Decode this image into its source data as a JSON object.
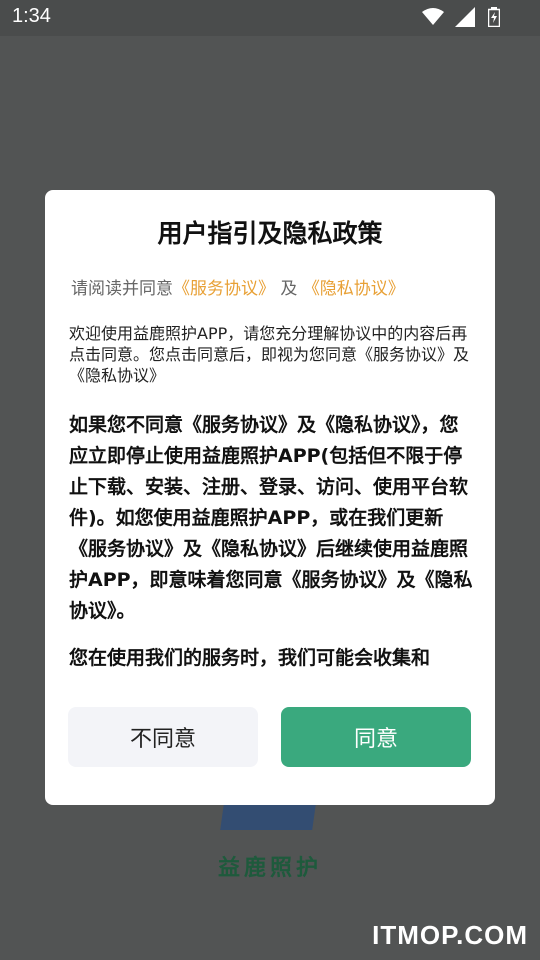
{
  "status_bar": {
    "time": "1:34"
  },
  "background": {
    "app_name": "益鹿照护",
    "watermark": "ITMOP.COM"
  },
  "dialog": {
    "title": "用户指引及隐私政策",
    "subtitle_prefix": "请阅读并同意",
    "service_link": "《服务协议》",
    "subtitle_and": "及",
    "privacy_link": "《隐私协议》",
    "intro": "欢迎使用益鹿照护APP，请您充分理解协议中的内容后再点击同意。您点击同意后，即视为您同意《服务协议》及《隐私协议》",
    "paragraph_1": "如果您不同意《服务协议》及《隐私协议》，您应立即停止使用益鹿照护APP(包括但不限于停止下载、安装、注册、登录、访问、使用平台软件)。如您使用益鹿照护APP，或在我们更新《服务协议》及《隐私协议》后继续使用益鹿照护APP，即意味着您同意《服务协议》及《隐私协议》。",
    "paragraph_2": "您在使用我们的服务时，我们可能会收集和",
    "disagree_label": "不同意",
    "agree_label": "同意"
  },
  "colors": {
    "accent": "#3aa97e",
    "link": "#e8a035",
    "overlay": "#525454"
  }
}
